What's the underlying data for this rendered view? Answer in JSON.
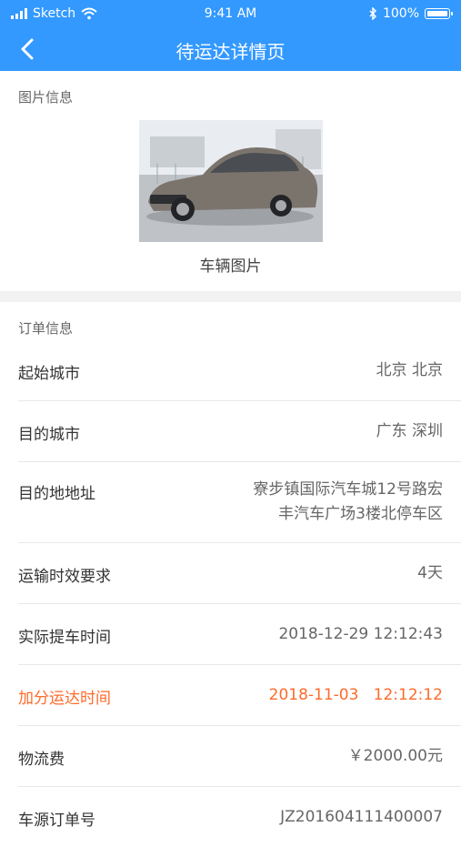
{
  "status_bar": {
    "carrier": "Sketch",
    "time": "9:41 AM",
    "battery": "100%"
  },
  "nav": {
    "title": "待运达详情页"
  },
  "image_section": {
    "label": "图片信息",
    "caption": "车辆图片"
  },
  "order_section": {
    "label": "订单信息",
    "rows": [
      {
        "label": "起始城市",
        "value": "北京 北京"
      },
      {
        "label": "目的城市",
        "value": "广东 深圳"
      },
      {
        "label": "目的地地址",
        "value_lines": [
          "寮步镇国际汽车城12号路宏",
          "丰汽车广场3楼北停车区"
        ]
      },
      {
        "label": "运输时效要求",
        "value": "4天"
      },
      {
        "label": "实际提车时间",
        "value": "2018-12-29 12:12:43"
      },
      {
        "label": "加分运达时间",
        "value": "2018-11-03   12:12:12"
      },
      {
        "label": "物流费",
        "value": "￥2000.00元"
      },
      {
        "label": "车源订单号",
        "value": "JZ201604111400007"
      }
    ]
  },
  "colors": {
    "primary": "#3399ff",
    "highlight": "#ff6a2a"
  }
}
